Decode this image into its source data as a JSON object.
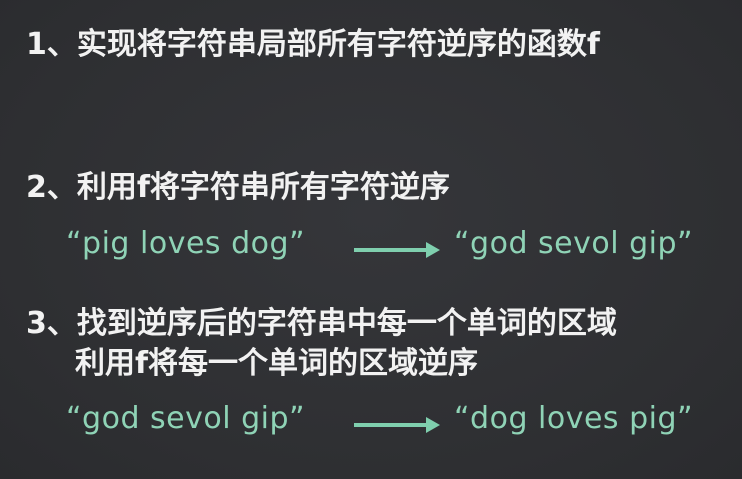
{
  "colors": {
    "background": "#2f3033",
    "heading_text": "#f2f2f2",
    "example_text": "#8fd3b6",
    "arrow": "#7fcfae"
  },
  "steps": [
    {
      "number": "1、",
      "lines": [
        "实现将字符串局部所有字符逆序的函数f"
      ]
    },
    {
      "number": "2、",
      "lines": [
        "利用f将字符串所有字符逆序"
      ],
      "example": {
        "from": "“pig loves dog”",
        "to": "“god sevol gip”",
        "arrow_icon": "right-arrow-icon"
      }
    },
    {
      "number": "3、",
      "lines": [
        "找到逆序后的字符串中每一个单词的区域",
        "利用f将每一个单词的区域逆序"
      ],
      "example": {
        "from": "“god sevol gip”",
        "to": "“dog loves pig”",
        "arrow_icon": "right-arrow-icon"
      }
    }
  ]
}
